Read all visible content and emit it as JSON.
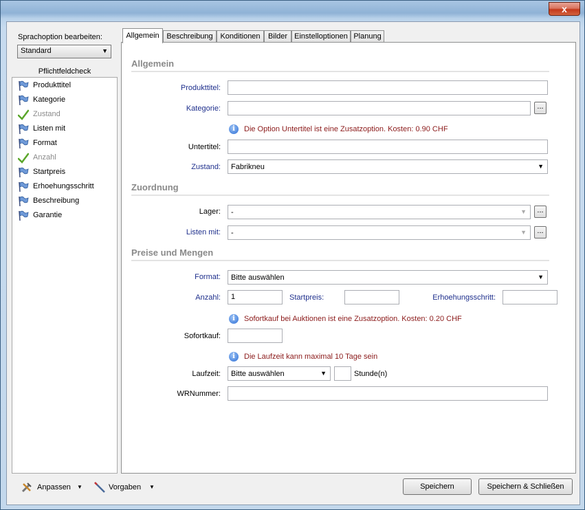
{
  "window": {
    "close_label": "x"
  },
  "left": {
    "language_label": "Sprachoption bearbeiten:",
    "language_value": "Standard",
    "check_title": "Pflichtfeldcheck",
    "check_items": [
      {
        "label": "Produkttitel",
        "status": "flag"
      },
      {
        "label": "Kategorie",
        "status": "flag"
      },
      {
        "label": "Zustand",
        "status": "ok"
      },
      {
        "label": "Listen mit",
        "status": "flag"
      },
      {
        "label": "Format",
        "status": "flag"
      },
      {
        "label": "Anzahl",
        "status": "ok"
      },
      {
        "label": "Startpreis",
        "status": "flag"
      },
      {
        "label": "Erhoehungsschritt",
        "status": "flag"
      },
      {
        "label": "Beschreibung",
        "status": "flag"
      },
      {
        "label": "Garantie",
        "status": "flag"
      }
    ]
  },
  "tabs": [
    "Allgemein",
    "Beschreibung",
    "Konditionen",
    "Bilder",
    "Einstelloptionen",
    "Planung"
  ],
  "panel": {
    "sec_allgemein": "Allgemein",
    "produkttitel_label": "Produkttitel:",
    "produkttitel_value": "",
    "kategorie_label": "Kategorie:",
    "kategorie_value": "",
    "browse_label": "...",
    "untertitel_info": "Die Option Untertitel ist eine Zusatzoption. Kosten: 0.90 CHF",
    "untertitel_label": "Untertitel:",
    "untertitel_value": "",
    "zustand_label": "Zustand:",
    "zustand_value": "Fabrikneu",
    "sec_zuordnung": "Zuordnung",
    "lager_label": "Lager:",
    "lager_value": "-",
    "listen_label": "Listen mit:",
    "listen_value": "-",
    "sec_preise": "Preise und Mengen",
    "format_label": "Format:",
    "format_value": "Bitte auswählen",
    "anzahl_label": "Anzahl:",
    "anzahl_value": "1",
    "startpreis_label": "Startpreis:",
    "startpreis_value": "",
    "erhoehung_label": "Erhoehungsschritt:",
    "erhoehung_value": "",
    "sofortkauf_info": "Sofortkauf bei Auktionen ist eine Zusatzoption. Kosten: 0.20 CHF",
    "sofortkauf_label": "Sofortkauf:",
    "sofortkauf_value": "",
    "laufzeit_info": "Die Laufzeit kann maximal 10 Tage sein",
    "laufzeit_label": "Laufzeit:",
    "laufzeit_value": "Bitte auswählen",
    "stunden_value": "",
    "stunden_label": "Stunde(n)",
    "wrnummer_label": "WRNummer:",
    "wrnummer_value": ""
  },
  "bottom": {
    "anpassen_label": "Anpassen",
    "vorgaben_label": "Vorgaben",
    "speichern_label": "Speichern",
    "speichern_schliessen_label": "Speichern & Schließen"
  },
  "colors": {
    "required_label": "#1e2f8c",
    "info_text": "#8b1a1a",
    "section_title": "#8a8a8a"
  }
}
